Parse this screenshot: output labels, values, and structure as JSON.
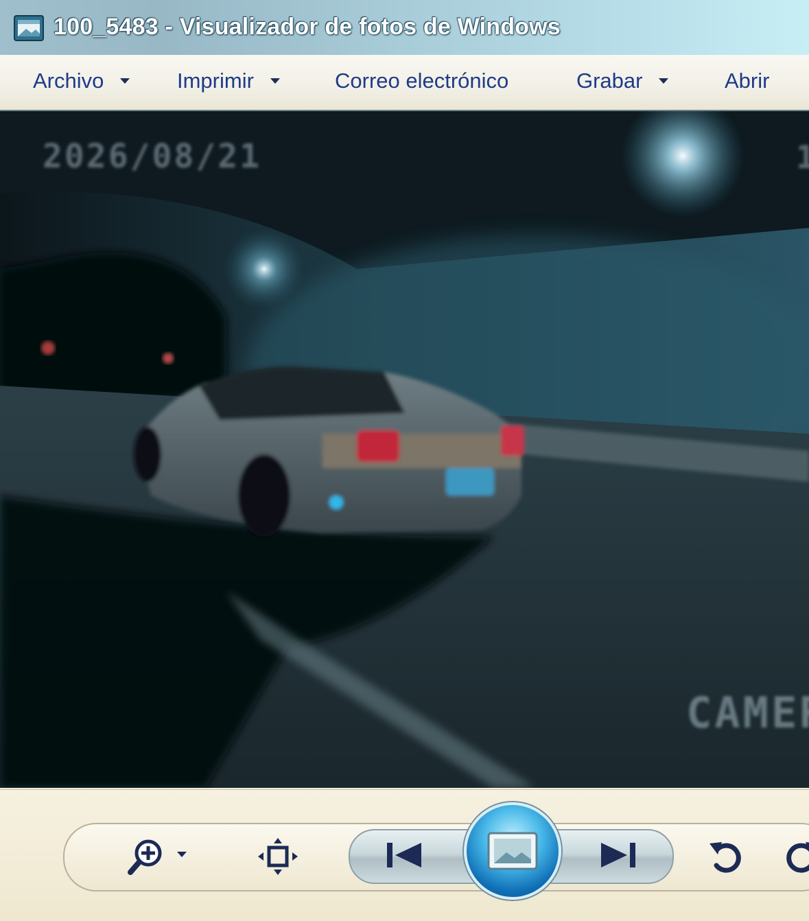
{
  "window": {
    "title": "100_5483 - Visualizador de fotos de Windows",
    "icon": "photo-viewer-icon"
  },
  "menubar": {
    "items": [
      {
        "label": "Archivo",
        "has_dropdown": true
      },
      {
        "label": "Imprimir",
        "has_dropdown": true
      },
      {
        "label": "Correo electrónico",
        "has_dropdown": false
      },
      {
        "label": "Grabar",
        "has_dropdown": true
      },
      {
        "label": "Abrir",
        "has_dropdown": false
      }
    ]
  },
  "photo": {
    "date_stamp": "2026/08/21",
    "camera_stamp": "CAMER",
    "edge_stamp": "1"
  },
  "controls": {
    "zoom": "zoom-in-icon",
    "fit": "actual-size-icon",
    "previous": "previous-icon",
    "slideshow": "slideshow-icon",
    "next": "next-icon",
    "rotate_left": "rotate-counterclockwise-icon",
    "rotate_right": "rotate-clockwise-icon"
  },
  "colors": {
    "menu_text": "#1e3a8a",
    "title_text": "#ffffff",
    "slideshow_blue": "#1a8fd4"
  }
}
